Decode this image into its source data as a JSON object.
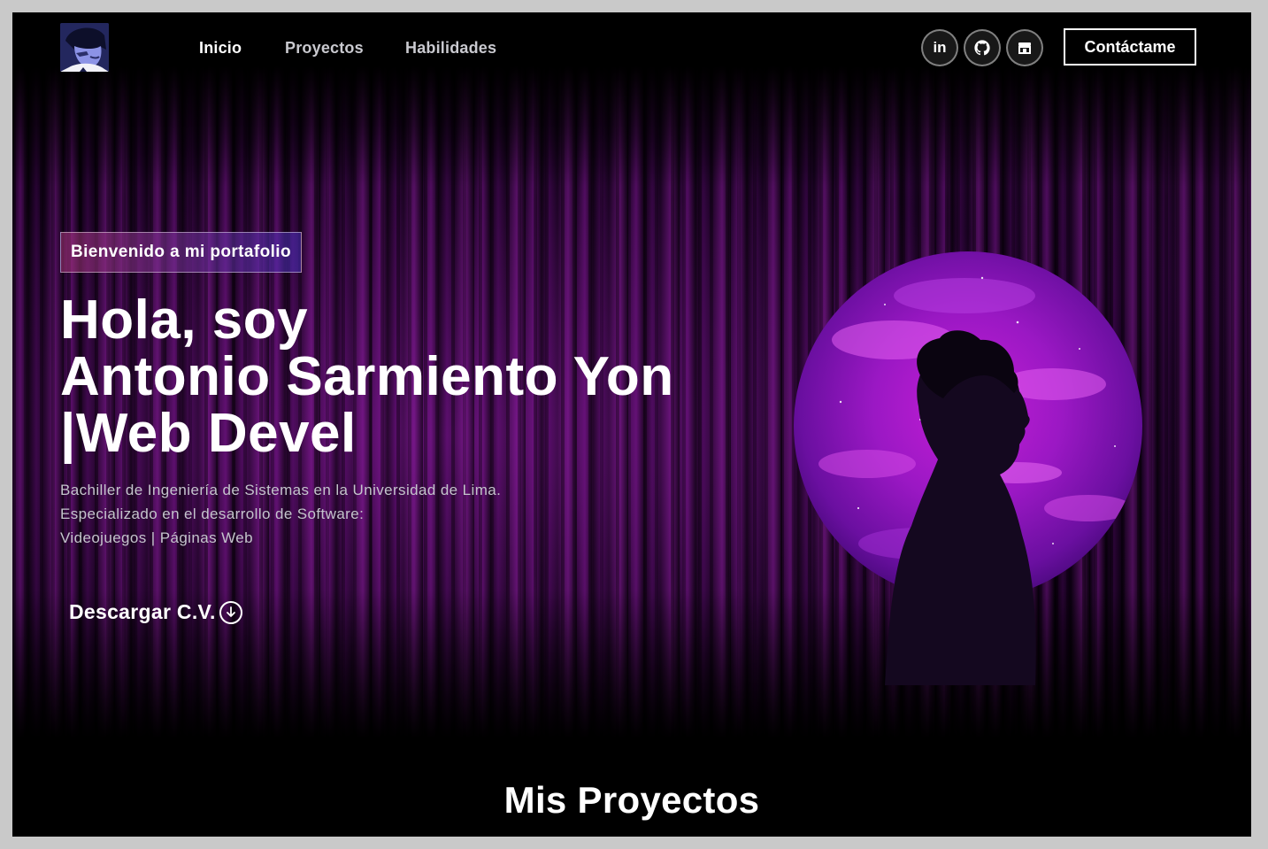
{
  "nav": {
    "logo_alt": "avatar",
    "links": [
      {
        "label": "Inicio"
      },
      {
        "label": "Proyectos"
      },
      {
        "label": "Habilidades"
      }
    ],
    "social": [
      {
        "icon": "linkedin-icon",
        "glyph": "in"
      },
      {
        "icon": "github-icon",
        "glyph": ""
      },
      {
        "icon": "store-icon",
        "glyph": ""
      }
    ],
    "contact_label": "Contáctame"
  },
  "hero": {
    "badge": "Bienvenido a mi portafolio",
    "title_line1": "Hola, soy",
    "title_line2": "Antonio Sarmiento Yon",
    "title_line3": "|Web Devel",
    "desc_line1": "Bachiller de Ingeniería de Sistemas en la Universidad de Lima.",
    "desc_line2": "Especializado en el desarrollo de Software:",
    "desc_line3": "Videojuegos | Páginas Web",
    "download_label": "Descargar C.V.",
    "download_icon": "arrow-down-circle-icon"
  },
  "projects": {
    "title": "Mis Proyectos"
  },
  "colors": {
    "accent_purple": "#9b2fc7",
    "badge_from": "#aa367c",
    "badge_to": "#4a2fbd",
    "background": "#000000"
  }
}
